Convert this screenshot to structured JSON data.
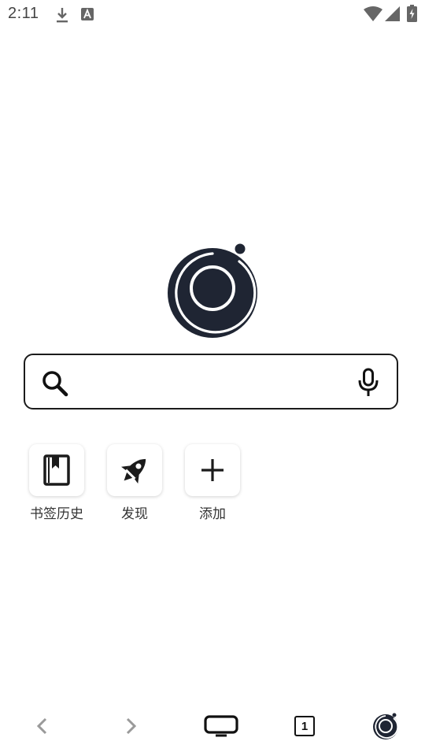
{
  "status_bar": {
    "time": "2:11",
    "icons": [
      "download-icon",
      "font-notification-icon",
      "wifi-icon",
      "cell-signal-icon",
      "battery-charging-icon"
    ]
  },
  "logo": {
    "name": "browser-logo"
  },
  "search": {
    "value": "",
    "placeholder": "",
    "icons": [
      "search-icon",
      "mic-icon"
    ]
  },
  "shortcuts": [
    {
      "label": "书签历史",
      "icon": "bookmark-icon"
    },
    {
      "label": "发现",
      "icon": "rocket-icon"
    },
    {
      "label": "添加",
      "icon": "plus-icon"
    }
  ],
  "bottom_bar": {
    "tab_count": "1",
    "icons": [
      "back-icon",
      "forward-icon",
      "tv-mode-icon",
      "tabs-icon",
      "browser-menu-icon"
    ]
  },
  "colors": {
    "logo_dark": "#1f2533",
    "icon_dark": "#1b1b1b",
    "nav_disabled": "#9a9a9a"
  }
}
